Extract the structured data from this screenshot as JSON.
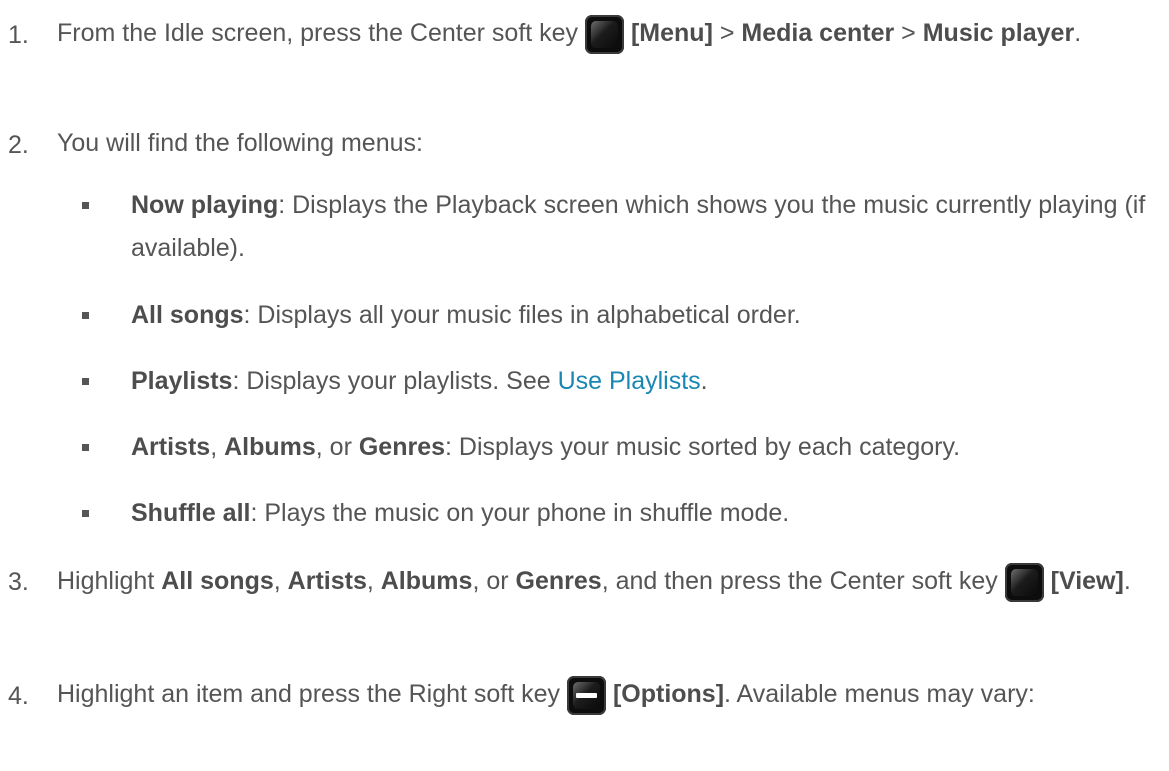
{
  "steps": [
    {
      "number": "1.",
      "parts": [
        {
          "t": "From the Idle screen, press the Center soft key "
        },
        {
          "icon": "center"
        },
        {
          "t": " "
        },
        {
          "b": "[Menu]"
        },
        {
          "t": " > "
        },
        {
          "b": "Media center"
        },
        {
          "t": " > "
        },
        {
          "b": "Music player"
        },
        {
          "t": "."
        }
      ]
    },
    {
      "number": "2.",
      "parts": [
        {
          "t": "You will find the following menus:"
        }
      ]
    },
    {
      "number": "3.",
      "parts": [
        {
          "t": "Highlight "
        },
        {
          "b": "All songs"
        },
        {
          "t": ", "
        },
        {
          "b": "Artists"
        },
        {
          "t": ", "
        },
        {
          "b": "Albums"
        },
        {
          "t": ", or "
        },
        {
          "b": "Genres"
        },
        {
          "t": ", and then press the Center soft key "
        },
        {
          "icon": "center"
        },
        {
          "t": " "
        },
        {
          "b": "[View]"
        },
        {
          "t": "."
        }
      ]
    },
    {
      "number": "4.",
      "parts": [
        {
          "t": "Highlight an item and press the Right soft key "
        },
        {
          "icon": "right"
        },
        {
          "t": " "
        },
        {
          "b": "[Options]"
        },
        {
          "t": ". Available menus may vary:"
        }
      ]
    }
  ],
  "menus": [
    {
      "parts": [
        {
          "b": "Now playing"
        },
        {
          "t": ": Displays the Playback screen which shows you the music currently playing (if available)."
        }
      ]
    },
    {
      "parts": [
        {
          "b": "All songs"
        },
        {
          "t": ": Displays all your music files in alphabetical order."
        }
      ]
    },
    {
      "parts": [
        {
          "b": "Playlists"
        },
        {
          "t": ": Displays your playlists. See "
        },
        {
          "link": "Use Playlists"
        },
        {
          "t": "."
        }
      ]
    },
    {
      "parts": [
        {
          "b": "Artists"
        },
        {
          "t": ", "
        },
        {
          "b": "Albums"
        },
        {
          "t": ", or "
        },
        {
          "b": "Genres"
        },
        {
          "t": ": Displays your music sorted by each category."
        }
      ]
    },
    {
      "parts": [
        {
          "b": "Shuffle all"
        },
        {
          "t": ": Plays the music on your phone in shuffle mode."
        }
      ]
    }
  ],
  "icons": {
    "center": "center-soft-key-icon",
    "right": "right-soft-key-icon"
  }
}
